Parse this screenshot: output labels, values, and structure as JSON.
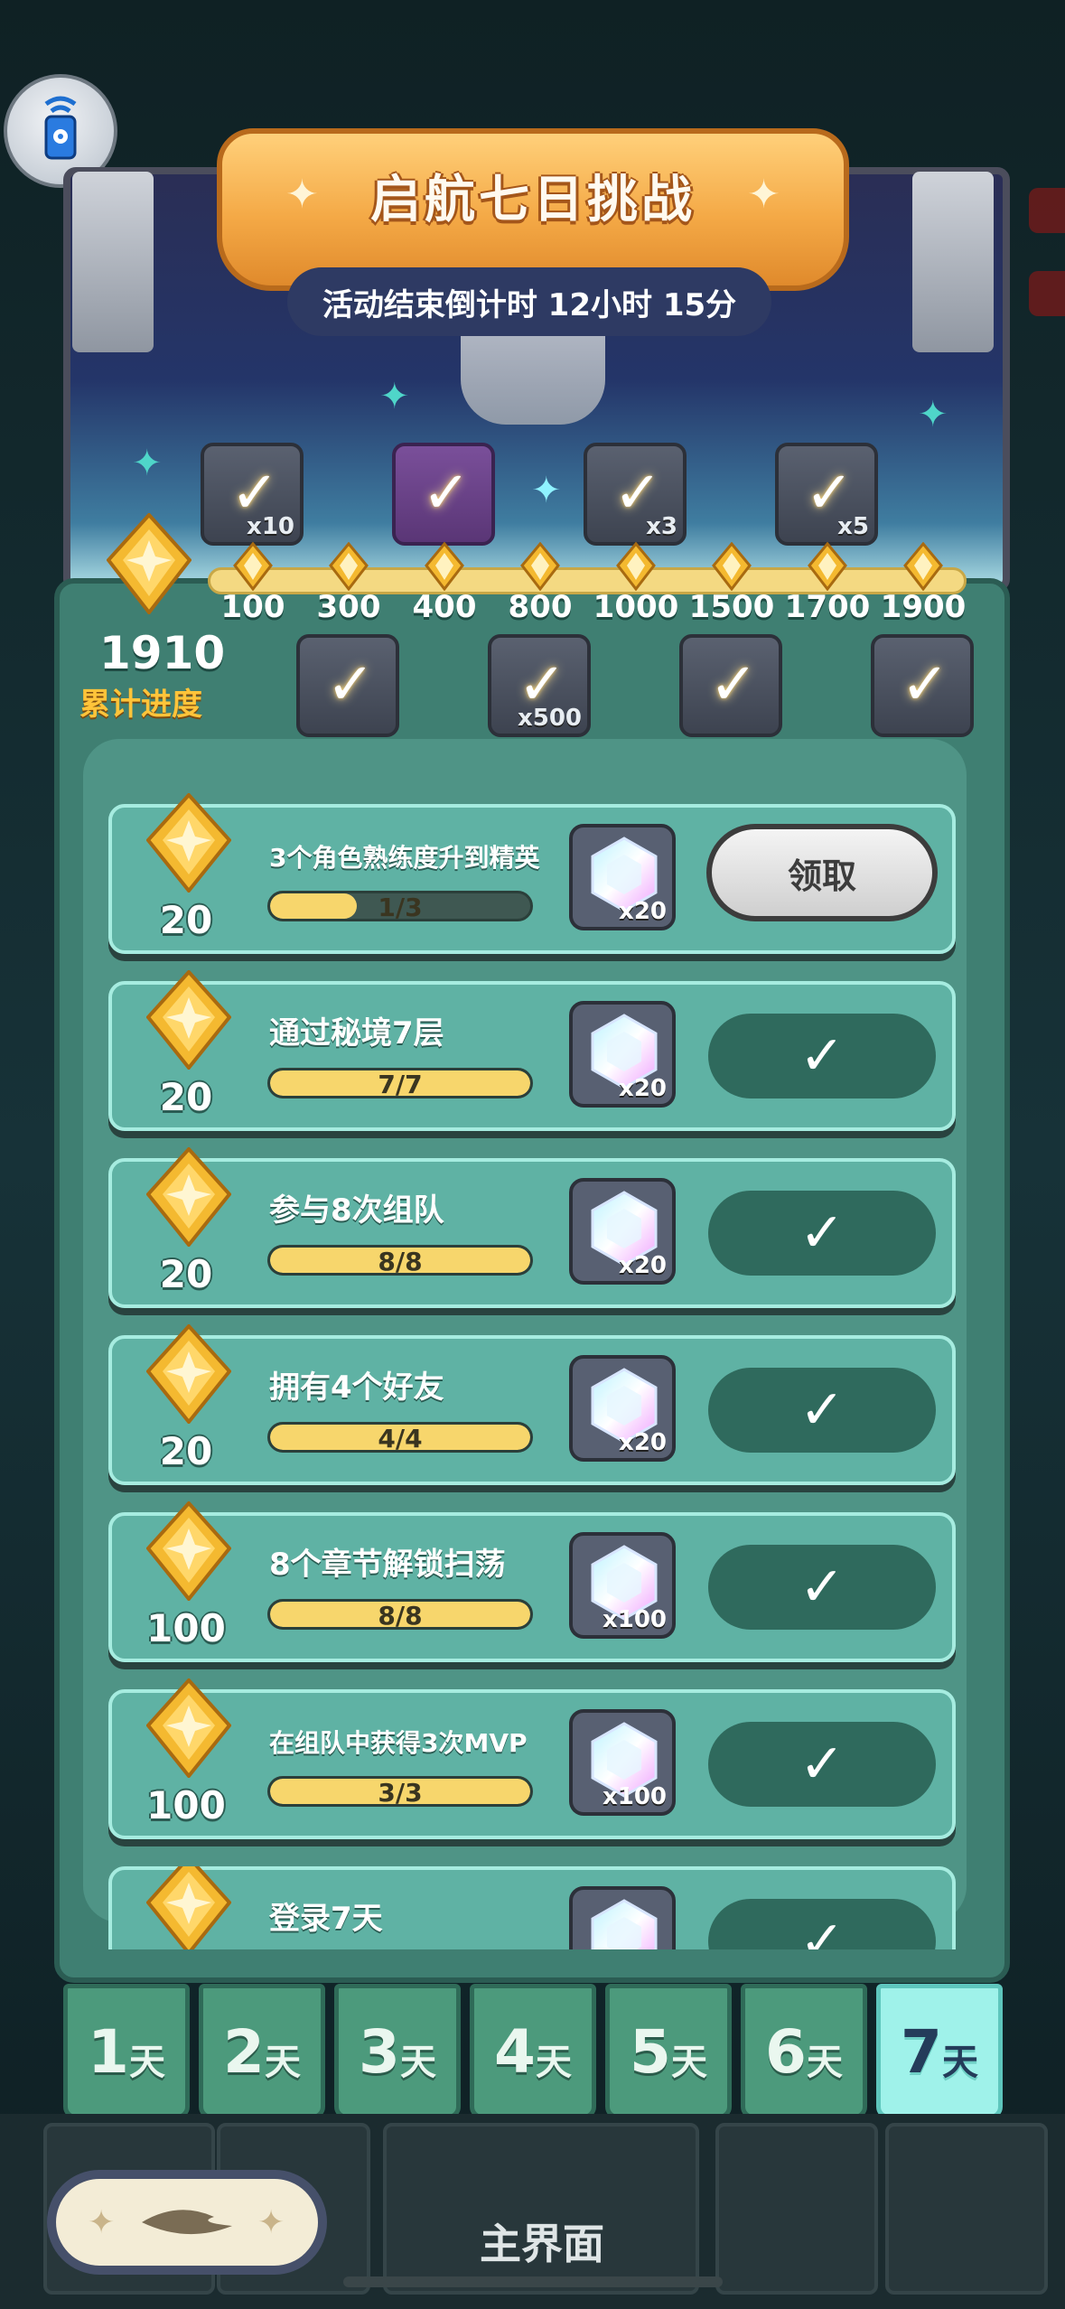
{
  "header": {
    "title": "启航七日挑战",
    "countdown": "活动结束倒计时 12小时 15分"
  },
  "progress": {
    "total_value": "1910",
    "total_label": "累计进度",
    "milestones": [
      {
        "label": "100",
        "reward_qty": "",
        "claimed": true
      },
      {
        "label": "300",
        "reward_qty": "x10",
        "claimed": true
      },
      {
        "label": "400",
        "reward_qty": "",
        "claimed": true
      },
      {
        "label": "800",
        "reward_qty": "",
        "claimed": true
      },
      {
        "label": "1000",
        "reward_qty": "x3",
        "claimed": true
      },
      {
        "label": "1500",
        "reward_qty": "x500",
        "claimed": true
      },
      {
        "label": "1700",
        "reward_qty": "",
        "claimed": true
      },
      {
        "label": "1900",
        "reward_qty": "x5",
        "claimed": true
      }
    ]
  },
  "tasks": [
    {
      "points": "20",
      "desc": "3个角色熟练度升到精英",
      "progress_text": "1/3",
      "progress_frac": 0.333,
      "reward_qty": "x20",
      "state": "claim",
      "action_label": "领取"
    },
    {
      "points": "20",
      "desc": "通过秘境7层",
      "progress_text": "7/7",
      "progress_frac": 1,
      "reward_qty": "x20",
      "state": "done"
    },
    {
      "points": "20",
      "desc": "参与8次组队",
      "progress_text": "8/8",
      "progress_frac": 1,
      "reward_qty": "x20",
      "state": "done"
    },
    {
      "points": "20",
      "desc": "拥有4个好友",
      "progress_text": "4/4",
      "progress_frac": 1,
      "reward_qty": "x20",
      "state": "done"
    },
    {
      "points": "100",
      "desc": "8个章节解锁扫荡",
      "progress_text": "8/8",
      "progress_frac": 1,
      "reward_qty": "x100",
      "state": "done"
    },
    {
      "points": "100",
      "desc": "在组队中获得3次MVP",
      "progress_text": "3/3",
      "progress_frac": 1,
      "reward_qty": "x100",
      "state": "done"
    },
    {
      "points": "",
      "desc": "登录7天",
      "progress_text": "",
      "progress_frac": 1,
      "reward_qty": "",
      "state": "done"
    }
  ],
  "day_tabs": [
    {
      "num": "1",
      "unit": "天"
    },
    {
      "num": "2",
      "unit": "天"
    },
    {
      "num": "3",
      "unit": "天"
    },
    {
      "num": "4",
      "unit": "天"
    },
    {
      "num": "5",
      "unit": "天"
    },
    {
      "num": "6",
      "unit": "天"
    },
    {
      "num": "7",
      "unit": "天"
    }
  ],
  "active_day": 7,
  "bottom_nav": {
    "main_label": "主界面"
  },
  "colors": {
    "panel": "#3f7f72",
    "task_bg": "#5fb2a4",
    "gold": "#ffc43a",
    "active_tab": "#9ff2ea"
  }
}
